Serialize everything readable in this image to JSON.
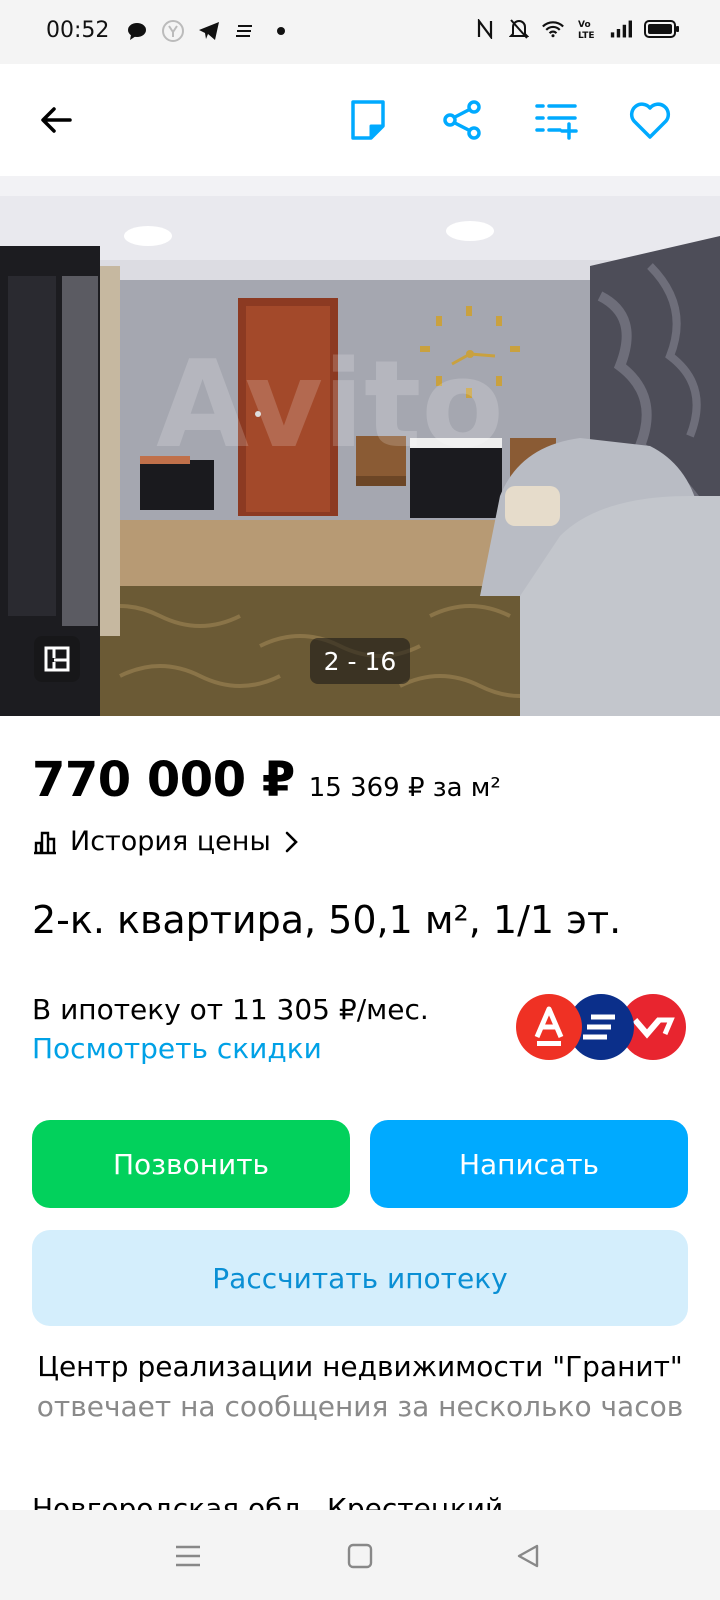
{
  "status_bar": {
    "time": "00:52",
    "left_icons": [
      "chat-icon",
      "yandex-icon",
      "telegram-icon",
      "notes-icon",
      "dot-icon"
    ],
    "right_icons": [
      "nfc-icon",
      "mute-icon",
      "wifi-icon",
      "volte-icon",
      "signal-icon",
      "battery-icon"
    ]
  },
  "toolbar": {
    "back_icon": "arrow-left-icon",
    "note_icon": "note-icon",
    "share_icon": "share-icon",
    "compare_icon": "compare-add-icon",
    "favorite_icon": "heart-icon",
    "accent_color": "#00aaff"
  },
  "gallery": {
    "counter": "2 - 16",
    "watermark": "Avito"
  },
  "listing": {
    "price": "770 000 ₽",
    "price_per_m2": "15 369 ₽ за м²",
    "price_history_label": "История цены",
    "title": "2-к. квартира, 50,1 м², 1/1 эт."
  },
  "mortgage": {
    "text": "В ипотеку от 11 305 ₽/мес.",
    "link": "Посмотреть скидки",
    "banks": [
      {
        "name": "Альфа-Банк",
        "letter": "А",
        "color": "#ef3124"
      },
      {
        "name": "bank-2",
        "letter": "",
        "color": "#0b2f8a"
      },
      {
        "name": "Почта Банк",
        "letter": "",
        "color": "#e8252f"
      }
    ]
  },
  "actions": {
    "call": "Позвонить",
    "write": "Написать",
    "calc_mortgage": "Рассчитать ипотеку"
  },
  "seller": {
    "name": "Центр реализации недвижимости \"Гранит\"",
    "response": "отвечает на сообщения за несколько часов"
  },
  "address": "Новгородская обл., Крестецкий",
  "nav_bar": {
    "menu_icon": "menu-icon",
    "home_icon": "square-icon",
    "back_icon": "triangle-back-icon"
  }
}
